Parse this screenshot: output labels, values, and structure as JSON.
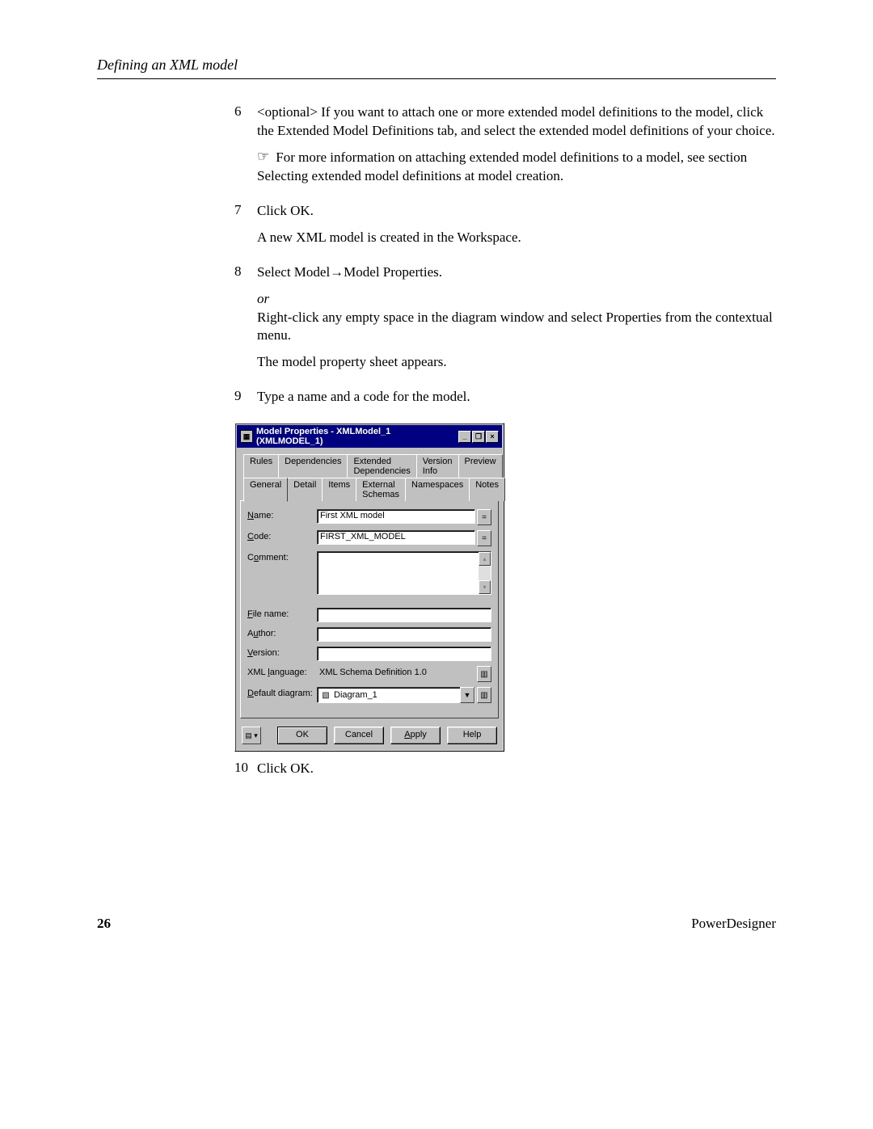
{
  "header": "Defining an XML model",
  "steps": {
    "s6": {
      "num": "6",
      "optional": "<optional>",
      "text_a": " If you want to attach one or more extended model definitions to the model, click the Extended Model Definitions tab, and select the extended model definitions of your choice.",
      "note_icon": "☞",
      "note": "For more information on attaching extended model definitions to a model, see section Selecting extended model definitions at model creation."
    },
    "s7": {
      "num": "7",
      "text_a": "Click OK.",
      "text_b": "A new XML model is created in the Workspace."
    },
    "s8": {
      "num": "8",
      "text_a": "Select Model→Model Properties.",
      "or": "or",
      "text_b": "Right-click any empty space in the diagram window and select Properties from the contextual menu.",
      "text_c": "The model property sheet appears."
    },
    "s9": {
      "num": "9",
      "text_a": "Type a name and a code for the model."
    },
    "s10": {
      "num": "10",
      "text_a": "Click OK."
    }
  },
  "dialog": {
    "title": "Model Properties - XMLModel_1 (XMLMODEL_1)",
    "win_minimize": "_",
    "win_restore": "❐",
    "win_close": "×",
    "tabs_row1": [
      "Rules",
      "Dependencies",
      "Extended Dependencies",
      "Version Info",
      "Preview"
    ],
    "tabs_row2": [
      "General",
      "Detail",
      "Items",
      "External Schemas",
      "Namespaces",
      "Notes"
    ],
    "active_tab": "General",
    "fields": {
      "name_label": "Name:",
      "name_value": "First XML model",
      "code_label": "Code:",
      "code_value": "FIRST_XML_MODEL",
      "comment_label": "Comment:",
      "filename_label": "File name:",
      "filename_value": "",
      "author_label": "Author:",
      "author_value": "",
      "version_label": "Version:",
      "version_value": "",
      "xmllang_label": "XML language:",
      "xmllang_value": "XML Schema Definition 1.0",
      "defdiag_label": "Default diagram:",
      "defdiag_value": "Diagram_1",
      "equals_btn": "=",
      "props_icon": "▥",
      "dd_arrow": "▼",
      "up_arrow": "▴",
      "down_arrow": "▾",
      "diagram_icon": "▧"
    },
    "buttons": {
      "menu_icon": "▤",
      "menu_arrow": "▾",
      "ok": "OK",
      "cancel": "Cancel",
      "apply": "Apply",
      "help": "Help"
    }
  },
  "footer": {
    "page_num": "26",
    "product": "PowerDesigner"
  }
}
